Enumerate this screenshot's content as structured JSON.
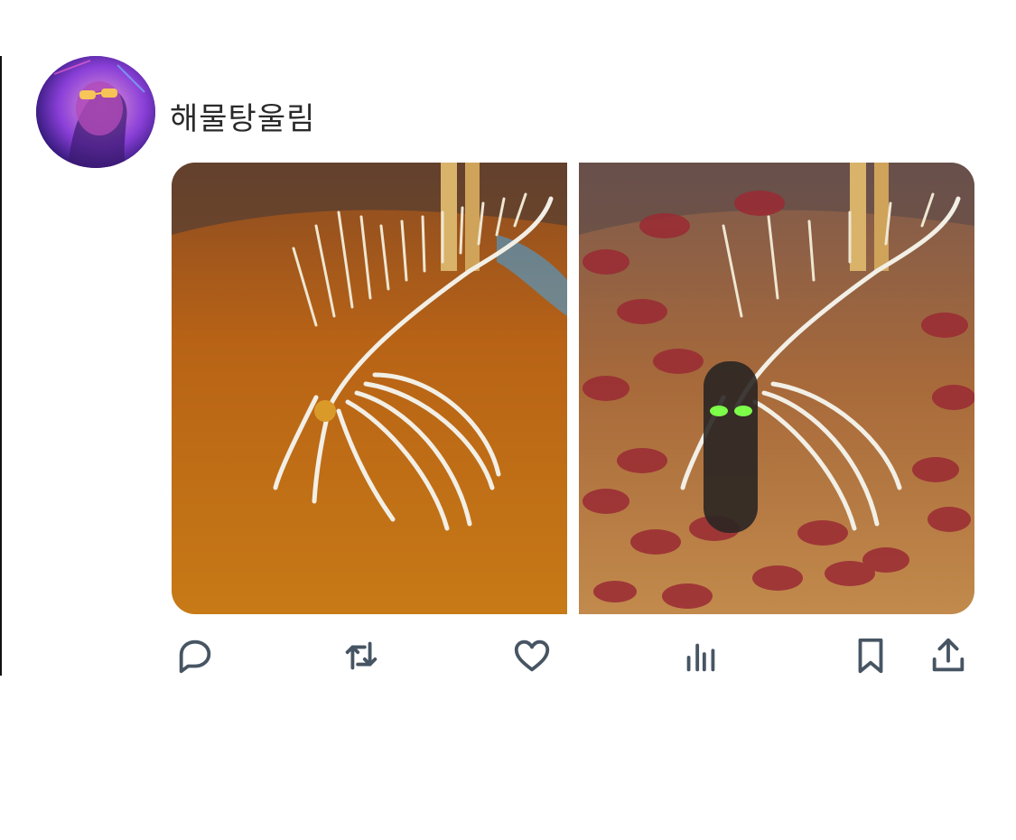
{
  "post": {
    "username": "해물탕울림",
    "avatar_icon": "avatar-photo-neon",
    "images": [
      {
        "name": "fish-skeleton-in-stew"
      },
      {
        "name": "fish-skeleton-in-stew-edited"
      }
    ]
  },
  "actions": {
    "reply_icon": "speech-bubble-icon",
    "repost_icon": "repost-arrows-icon",
    "like_icon": "heart-icon",
    "views_icon": "bar-chart-icon",
    "bookmark_icon": "bookmark-icon",
    "share_icon": "share-upload-icon"
  },
  "colors": {
    "icon": "#475563",
    "text": "#2a2a2a"
  }
}
